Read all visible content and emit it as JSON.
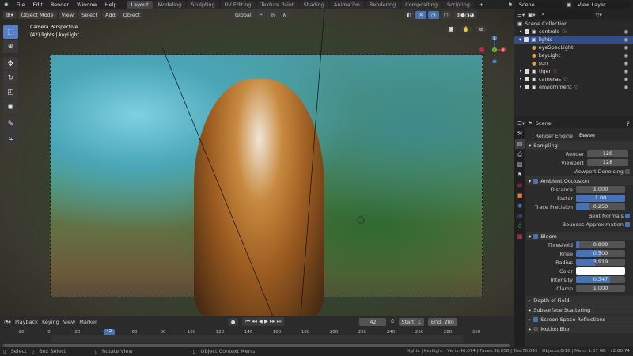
{
  "menu": [
    "File",
    "Edit",
    "Render",
    "Window",
    "Help"
  ],
  "workspaces": [
    "Layout",
    "Modeling",
    "Sculpting",
    "UV Editing",
    "Texture Paint",
    "Shading",
    "Animation",
    "Rendering",
    "Compositing",
    "Scripting"
  ],
  "active_workspace": "Layout",
  "scene_name": "Scene",
  "view_layer": "View Layer",
  "viewport": {
    "mode": "Object Mode",
    "menus": [
      "View",
      "Select",
      "Add",
      "Object"
    ],
    "orientation": "Global",
    "overlay_title": "Camera Perspective",
    "overlay_sub": "(42) lights | keyLight",
    "gizmo_axes": [
      "Z",
      "Y",
      "X"
    ]
  },
  "outliner": {
    "root": "Scene Collection",
    "items": [
      {
        "label": "controls",
        "level": 0,
        "selected": false
      },
      {
        "label": "lights",
        "level": 0,
        "selected": true
      },
      {
        "label": "eyeSpecLight",
        "level": 1,
        "selected": false
      },
      {
        "label": "keyLight",
        "level": 1,
        "selected": false
      },
      {
        "label": "sun",
        "level": 1,
        "selected": false
      },
      {
        "label": "tiger",
        "level": 0,
        "selected": false
      },
      {
        "label": "cameras",
        "level": 0,
        "selected": false
      },
      {
        "label": "enviornment",
        "level": 0,
        "selected": false
      }
    ]
  },
  "properties": {
    "context": "Scene",
    "render_engine_label": "Render Engine",
    "render_engine": "Eevee",
    "sampling": {
      "title": "Sampling",
      "render_label": "Render",
      "render": "128",
      "viewport_label": "Viewport",
      "viewport": "128",
      "denoise_label": "Viewport Denoising"
    },
    "ao": {
      "title": "Ambient Occlusion",
      "distance_label": "Distance",
      "distance": "1.000",
      "factor_label": "Factor",
      "factor": "1.00",
      "trace_label": "Trace Precision",
      "trace": "0.250",
      "bent_label": "Bent Normals",
      "bounces_label": "Bounces Approximation"
    },
    "bloom": {
      "title": "Bloom",
      "threshold_label": "Threshold",
      "threshold": "0.800",
      "knee_label": "Knee",
      "knee": "0.500",
      "radius_label": "Radius",
      "radius": "3.919",
      "color_label": "Color",
      "intensity_label": "Intensity",
      "intensity": "0.347",
      "clamp_label": "Clamp",
      "clamp": "1.000"
    },
    "panels": [
      "Depth of Field",
      "Subsurface Scattering",
      "Screen Space Reflections",
      "Motion Blur"
    ]
  },
  "timeline": {
    "menus": [
      "Playback",
      "Keying",
      "View",
      "Marker"
    ],
    "current_frame": "42",
    "start_label": "Start:",
    "start": "1",
    "end_label": "End:",
    "end": "280",
    "ticks": [
      "-20",
      "0",
      "20",
      "40",
      "60",
      "80",
      "100",
      "120",
      "140",
      "160",
      "180",
      "200",
      "220",
      "240",
      "260",
      "280",
      "300"
    ]
  },
  "status": {
    "select": "Select",
    "box_select": "Box Select",
    "rotate": "Rotate View",
    "context_menu": "Object Context Menu",
    "info": "lights | keyLight | Verts:46,074 | Faces:38,658 | Tris:70,042 | Objects:0/16 | Mem: 1.57 GB | v2.80.74"
  },
  "colors": {
    "accent": "#4772b3",
    "selection": "#334d80"
  }
}
